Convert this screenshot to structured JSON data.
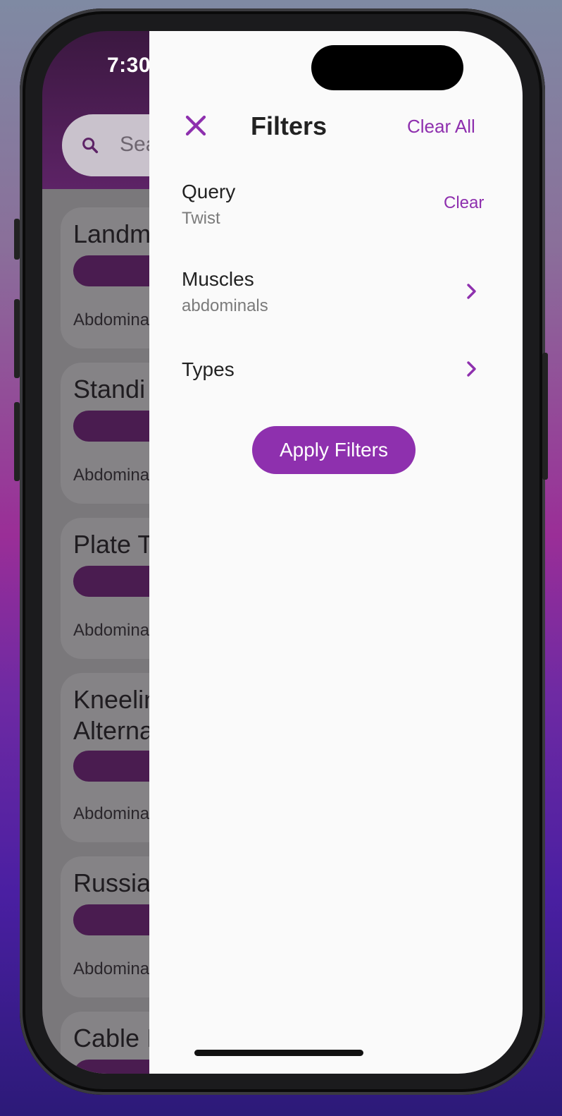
{
  "status_bar": {
    "time": "7:30"
  },
  "background_app": {
    "search_placeholder": "Search",
    "cards": [
      {
        "title": "Landm",
        "subtitle": "Abdomina"
      },
      {
        "title": "Standi",
        "subtitle": "Abdomina"
      },
      {
        "title": "Plate T",
        "subtitle": "Abdomina"
      },
      {
        "title": "Kneelin\nAlterna",
        "subtitle": "Abdomina"
      },
      {
        "title": "Russia",
        "subtitle": "Abdomina"
      },
      {
        "title": "Cable I",
        "subtitle": ""
      }
    ]
  },
  "filters": {
    "title": "Filters",
    "clear_all": "Clear All",
    "query": {
      "label": "Query",
      "value": "Twist",
      "clear": "Clear"
    },
    "muscles": {
      "label": "Muscles",
      "value": "abdominals"
    },
    "types": {
      "label": "Types"
    },
    "apply_button": "Apply Filters"
  },
  "colors": {
    "accent": "#8e30ae",
    "drawer_bg": "#fafafa"
  }
}
